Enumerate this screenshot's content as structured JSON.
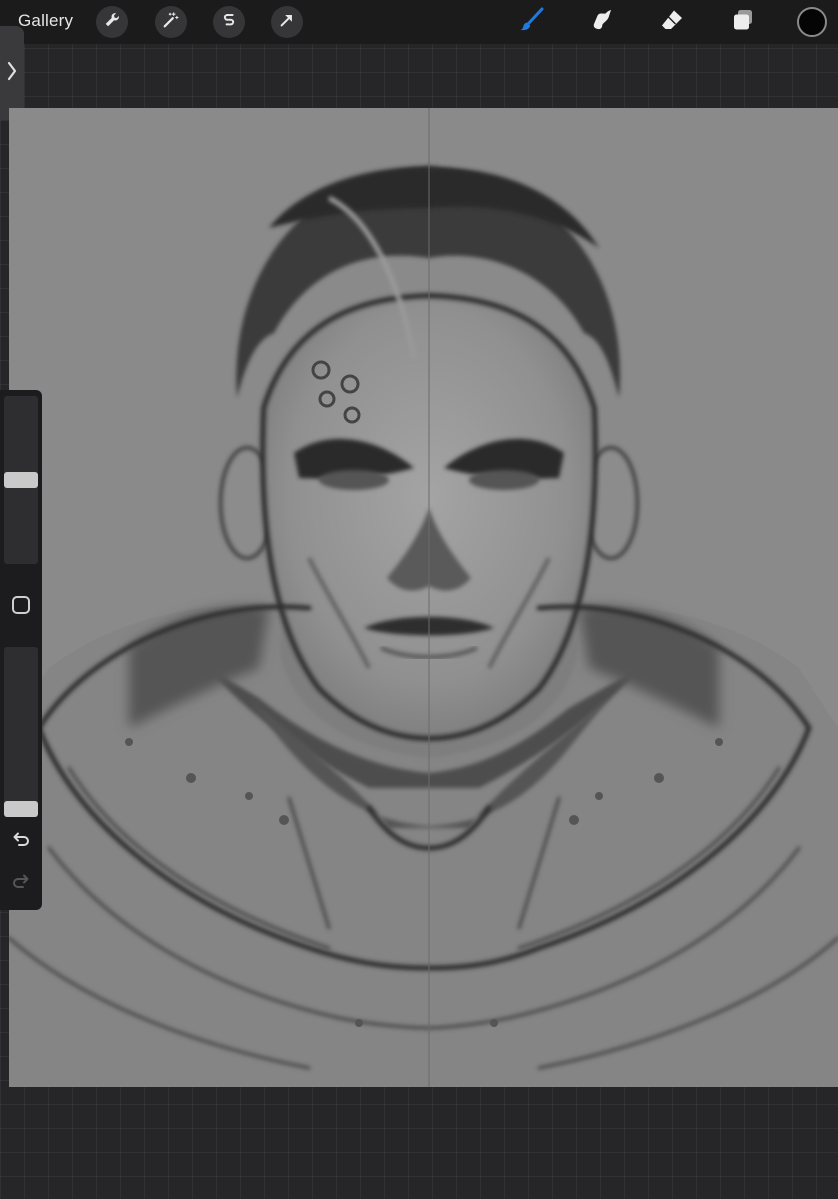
{
  "toolbar": {
    "gallery_label": "Gallery",
    "left_tools": [
      {
        "name": "actions",
        "icon": "wrench-icon"
      },
      {
        "name": "adjustments",
        "icon": "magic-wand-icon"
      },
      {
        "name": "selection",
        "icon": "selection-s-icon"
      },
      {
        "name": "transform",
        "icon": "arrow-cursor-icon"
      }
    ],
    "right_tools": [
      {
        "name": "brush",
        "icon": "brush-icon",
        "active": true
      },
      {
        "name": "smudge",
        "icon": "smudge-finger-icon",
        "active": false
      },
      {
        "name": "eraser",
        "icon": "eraser-icon",
        "active": false
      },
      {
        "name": "layers",
        "icon": "layers-icon",
        "active": false
      }
    ],
    "current_color": "#050505",
    "active_tool_color": "#1f7ae0"
  },
  "sidebar": {
    "brush_size_level": 0.5,
    "opacity_level": 0.0,
    "modify_button_icon": "square-icon",
    "undo_icon": "undo-arrow-icon",
    "redo_icon": "redo-arrow-icon"
  },
  "canvas": {
    "background_color": "#8a8a8a",
    "symmetry_guide": "vertical"
  }
}
